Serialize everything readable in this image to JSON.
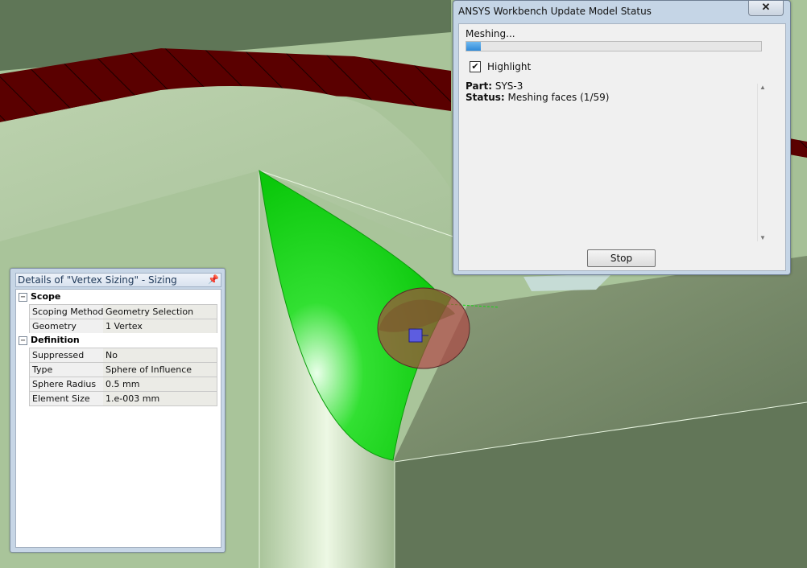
{
  "details_panel": {
    "title": "Details of \"Vertex Sizing\" - Sizing",
    "pin_icon": "pin-icon",
    "groups": [
      {
        "label": "Scope",
        "toggle": "−",
        "rows": [
          {
            "name": "Scoping Method",
            "value": "Geometry Selection"
          },
          {
            "name": "Geometry",
            "value": "1 Vertex"
          }
        ]
      },
      {
        "label": "Definition",
        "toggle": "−",
        "rows": [
          {
            "name": "Suppressed",
            "value": "No"
          },
          {
            "name": "Type",
            "value": "Sphere of Influence"
          },
          {
            "name": "Sphere Radius",
            "value": "0.5 mm"
          },
          {
            "name": "Element Size",
            "value": "1.e-003 mm"
          }
        ]
      }
    ]
  },
  "status_window": {
    "title": "ANSYS Workbench Update Model Status",
    "close_label": "✕",
    "meshing_label": "Meshing...",
    "progress": 0.05,
    "progress_color": "#2f8ad8",
    "highlight_checked": true,
    "highlight_label": "Highlight",
    "log": {
      "part_label": "Part:",
      "part_value": "SYS-3",
      "status_label": "Status:",
      "status_value": "Meshing faces (1/59)"
    },
    "stop_label": "Stop"
  },
  "colors": {
    "part_surface": "#a9c49a",
    "selected_face": "#12d812",
    "sphere": "#b04040",
    "vertex_marker": "#5d5de0",
    "edge_strip": "#5a0000"
  }
}
